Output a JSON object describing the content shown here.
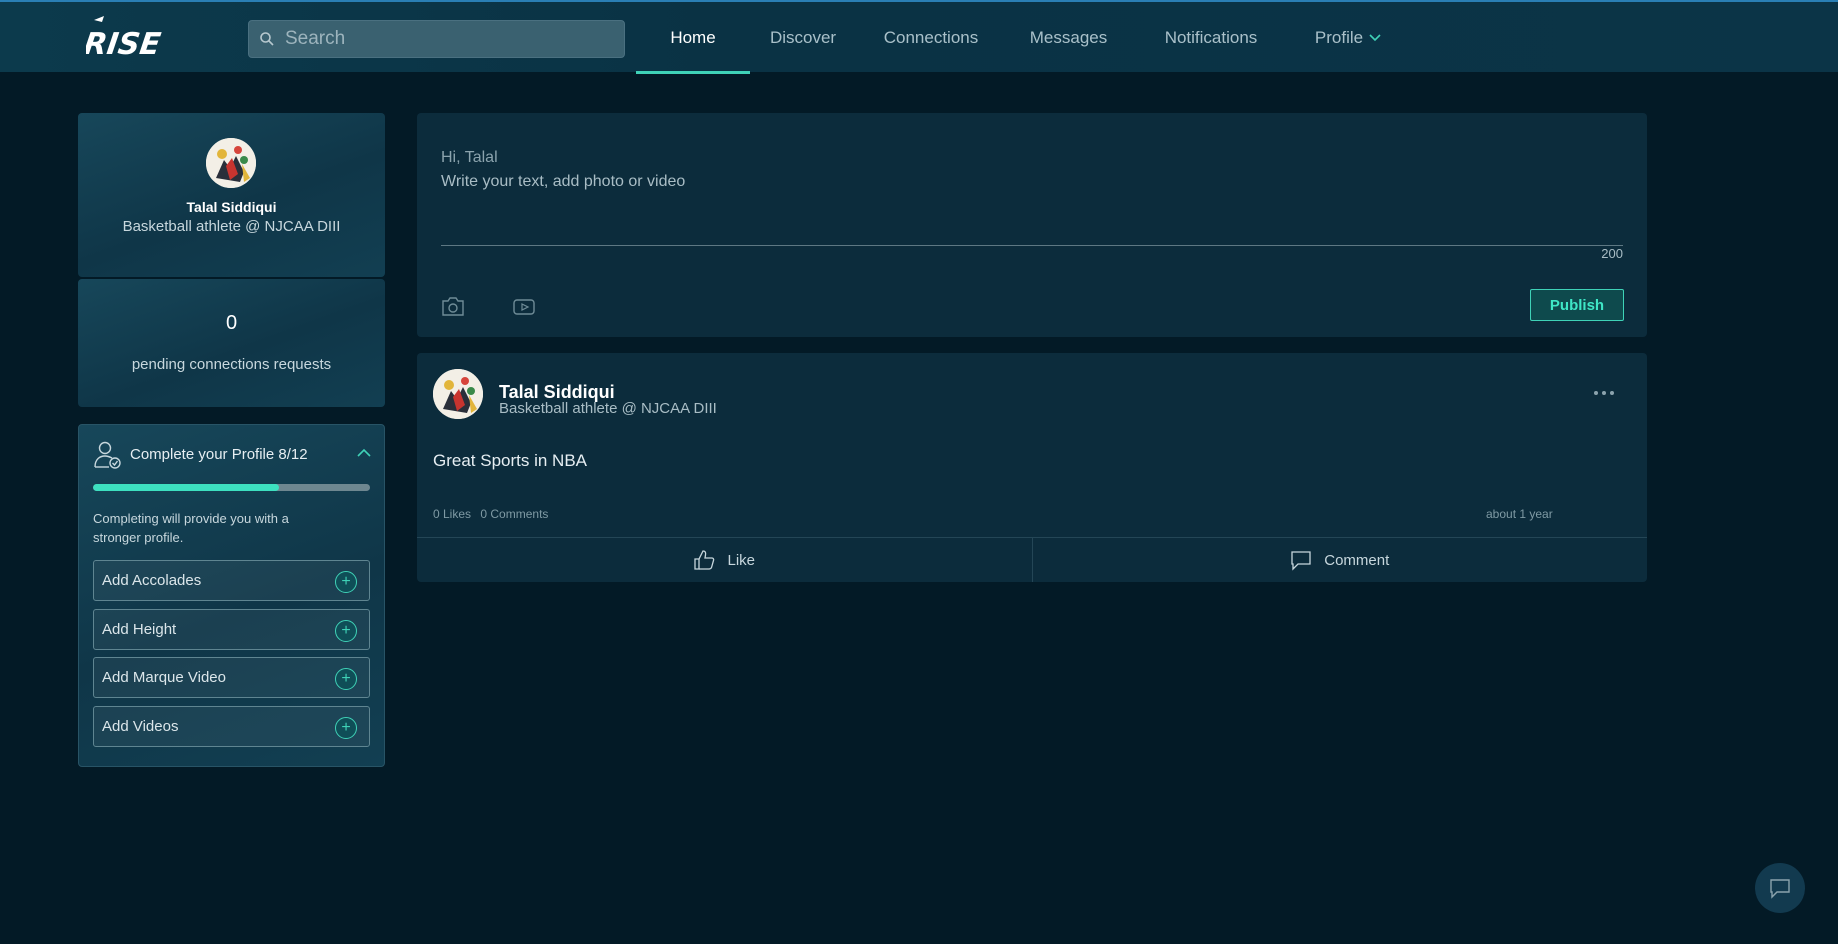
{
  "app": {
    "logo_text": "RISE"
  },
  "search": {
    "placeholder": "Search"
  },
  "nav": {
    "items": [
      {
        "label": "Home"
      },
      {
        "label": "Discover"
      },
      {
        "label": "Connections"
      },
      {
        "label": "Messages"
      },
      {
        "label": "Notifications"
      },
      {
        "label": "Profile"
      }
    ]
  },
  "sidebar": {
    "profile": {
      "name": "Talal Siddiqui",
      "title": "Basketball athlete @ NJCAA DIII"
    },
    "pending": {
      "count": "0",
      "label": "pending connections requests"
    },
    "complete_profile": {
      "title": "Complete your Profile 8/12",
      "progress": 0.67,
      "description": "Completing will provide you with a stronger profile.",
      "items": [
        {
          "label": "Add Accolades"
        },
        {
          "label": "Add Height"
        },
        {
          "label": "Add Marque Video"
        },
        {
          "label": "Add Videos"
        }
      ]
    }
  },
  "composer": {
    "greeting": "Hi, Talal",
    "placeholder": "Write your text, add photo or video",
    "char_count": "200",
    "publish_label": "Publish"
  },
  "post": {
    "author": "Talal Siddiqui",
    "subtitle": "Basketball athlete @ NJCAA DIII",
    "body": "Great Sports in NBA",
    "likes": "0 Likes",
    "comments": "0 Comments",
    "time": "about 1 year",
    "like_label": "Like",
    "comment_label": "Comment"
  },
  "colors": {
    "accent": "#3fd2b7",
    "background": "#031a26",
    "card": "#0c2c3c"
  }
}
